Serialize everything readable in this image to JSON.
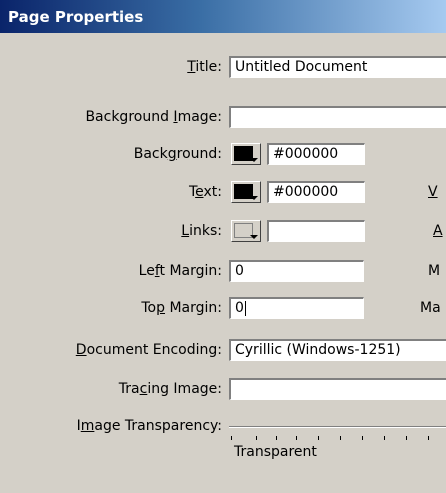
{
  "window": {
    "title": "Page Properties"
  },
  "form": {
    "title": {
      "label_pre": "",
      "label_u": "T",
      "label_post": "itle:",
      "value": "Untitled Document"
    },
    "bg_image": {
      "label_pre": "Background ",
      "label_u": "I",
      "label_post": "mage:",
      "value": ""
    },
    "background": {
      "label_pre": "Back",
      "label_u": "g",
      "label_post": "round:",
      "value": "#000000",
      "color": "#000000"
    },
    "text": {
      "label_pre": "T",
      "label_u": "e",
      "label_post": "xt:",
      "value": "#000000",
      "color": "#000000"
    },
    "links": {
      "label_pre": "",
      "label_u": "L",
      "label_post": "inks:",
      "value": ""
    },
    "left_margin": {
      "label_pre": "Le",
      "label_u": "f",
      "label_post": "t Margin:",
      "value": "0"
    },
    "top_margin": {
      "label_pre": "To",
      "label_u": "p",
      "label_post": " Margin:",
      "value": "0"
    },
    "encoding": {
      "label_pre": "",
      "label_u": "D",
      "label_post": "ocument Encoding:",
      "value": "Cyrillic (Windows-1251)"
    },
    "tracing_image": {
      "label_pre": "Tra",
      "label_u": "c",
      "label_post": "ing Image:",
      "value": ""
    },
    "transparency": {
      "label_pre": "I",
      "label_u": "m",
      "label_post": "age Transparency:",
      "min_label": "Transparent"
    }
  },
  "right_column": {
    "visited_partial": "V",
    "active_partial": "A",
    "margin_partial_1": "M",
    "margin_partial_2": "Ma"
  }
}
